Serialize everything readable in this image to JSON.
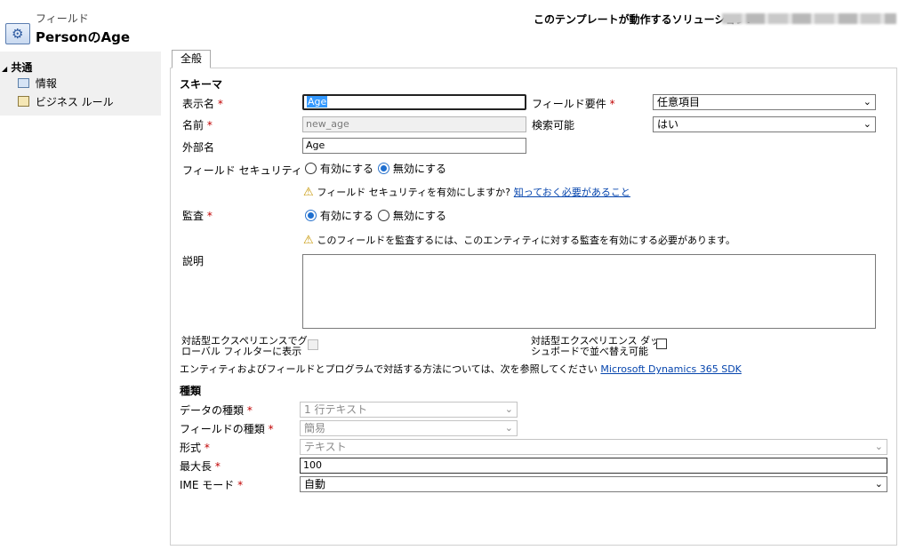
{
  "header": {
    "entity_type": "フィールド",
    "title": "PersonのAge",
    "solution_label": "このテンプレートが動作するソリューション:"
  },
  "nav": {
    "group": "共通",
    "items": [
      {
        "label": "情報"
      },
      {
        "label": "ビジネス ルール"
      }
    ]
  },
  "tabs": [
    "全般"
  ],
  "schema": {
    "section": "スキーマ",
    "display_name_label": "表示名",
    "display_name_value": "Age",
    "name_label": "名前",
    "name_value": "new_age",
    "external_name_label": "外部名",
    "external_name_value": "Age",
    "field_requirement_label": "フィールド要件",
    "field_requirement_value": "任意項目",
    "searchable_label": "検索可能",
    "searchable_value": "はい",
    "field_security_label": "フィールド セキュリティ",
    "enable_label": "有効にする",
    "disable_label": "無効にする",
    "field_security_selected": "無効にする",
    "security_warning": "フィールド セキュリティを有効にしますか?",
    "security_link": "知っておく必要があること",
    "audit_label": "監査",
    "audit_selected": "有効にする",
    "audit_warning": "このフィールドを監査するには、このエンティティに対する監査を有効にする必要があります。",
    "description_label": "説明",
    "global_filter_label_1": "対話型エクスペリエンスでグ",
    "global_filter_label_2": "ローバル フィルターに表示",
    "sortable_label_1": "対話型エクスペリエンス ダッ",
    "sortable_label_2": "シュボードで並べ替え可能",
    "sdk_text": "エンティティおよびフィールドとプログラムで対話する方法については、次を参照してください",
    "sdk_link": "Microsoft Dynamics 365 SDK"
  },
  "type": {
    "section": "種類",
    "data_type_label": "データの種類",
    "data_type_value": "1 行テキスト",
    "field_type_label": "フィールドの種類",
    "field_type_value": "簡易",
    "format_label": "形式",
    "format_value": "テキスト",
    "max_length_label": "最大長",
    "max_length_value": "100",
    "ime_label": "IME モード",
    "ime_value": "自動"
  },
  "required_mark": "*",
  "chevron": "⌄",
  "colors": {
    "required": "#c00000",
    "link": "#0645ad",
    "nav_bg": "#f0f0f0",
    "radio_selected": "#1e6fd0",
    "warning": "#c69500"
  },
  "icons": [
    "gear-icon",
    "info-icon",
    "business-rule-icon",
    "warning-icon",
    "chevron-down-icon"
  ]
}
